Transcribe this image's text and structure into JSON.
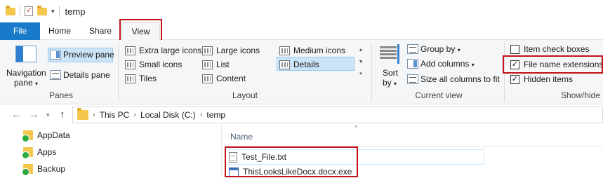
{
  "window": {
    "title": "temp",
    "quick_access": [
      "folder-icon",
      "properties-icon",
      "new-folder-icon",
      "customize-dropdown-icon"
    ]
  },
  "ribbon_tabs": [
    "File",
    "Home",
    "Share",
    "View"
  ],
  "ribbon": {
    "panes": {
      "label": "Panes",
      "navigation_pane_line1": "Navigation",
      "navigation_pane_line2": "pane",
      "preview_pane": "Preview pane",
      "details_pane": "Details pane"
    },
    "layout": {
      "label": "Layout",
      "extra_large_icons": "Extra large icons",
      "large_icons": "Large icons",
      "medium_icons": "Medium icons",
      "small_icons": "Small icons",
      "list": "List",
      "details": "Details",
      "tiles": "Tiles",
      "content": "Content",
      "selected": "Details"
    },
    "current_view": {
      "label": "Current view",
      "sort_by_line1": "Sort",
      "sort_by_line2": "by",
      "group_by": "Group by",
      "add_columns": "Add columns",
      "size_all_columns": "Size all columns to fit"
    },
    "show_hide": {
      "label": "Show/hide",
      "item_check_boxes": "Item check boxes",
      "file_name_extensions": "File name extensions",
      "hidden_items": "Hidden items",
      "item_check_boxes_checked": false,
      "file_name_extensions_checked": true,
      "hidden_items_checked": true
    }
  },
  "address_bar": {
    "crumbs": [
      "This PC",
      "Local Disk (C:)",
      "temp"
    ]
  },
  "nav_pane": {
    "items": [
      "AppData",
      "Apps",
      "Backup"
    ]
  },
  "file_list": {
    "column_name": "Name",
    "files": [
      {
        "name": "Test_File.txt",
        "icon": "text-file-icon"
      },
      {
        "name": "ThisLooksLikeDocx.docx.exe",
        "icon": "executable-file-icon"
      }
    ]
  },
  "colors": {
    "file_tab": "#1979ca",
    "highlight_box": "#c0131b",
    "selection": "#cce4f7",
    "folder": "#f4c64b"
  }
}
